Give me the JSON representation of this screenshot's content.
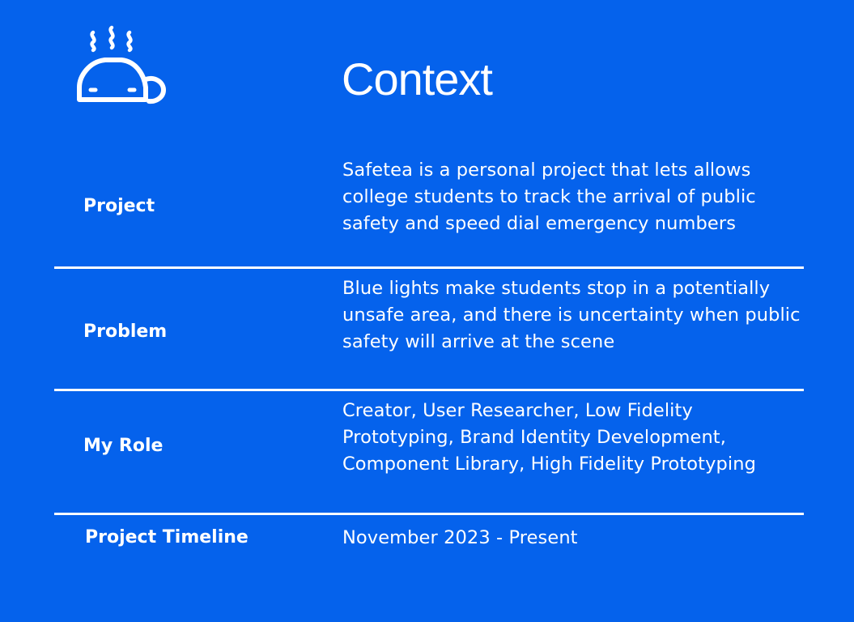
{
  "logo": {
    "icon": "steaming-teacup-car-icon"
  },
  "title": "Context",
  "rows": [
    {
      "label": "Project",
      "value": "Safetea is a personal project that lets allows college students to track the arrival of public safety and speed dial emergency numbers"
    },
    {
      "label": "Problem",
      "value": "Blue lights make students stop in a potentially unsafe area, and there is uncertainty when public safety will arrive at the scene"
    },
    {
      "label": "My Role",
      "value": "Creator, User Researcher, Low Fidelity Prototyping, Brand Identity Development, Component Library, High Fidelity Prototyping"
    },
    {
      "label": "Project Timeline",
      "value": "November 2023 - Present"
    }
  ],
  "colors": {
    "background": "#0562EC",
    "text": "#FFFFFF"
  }
}
